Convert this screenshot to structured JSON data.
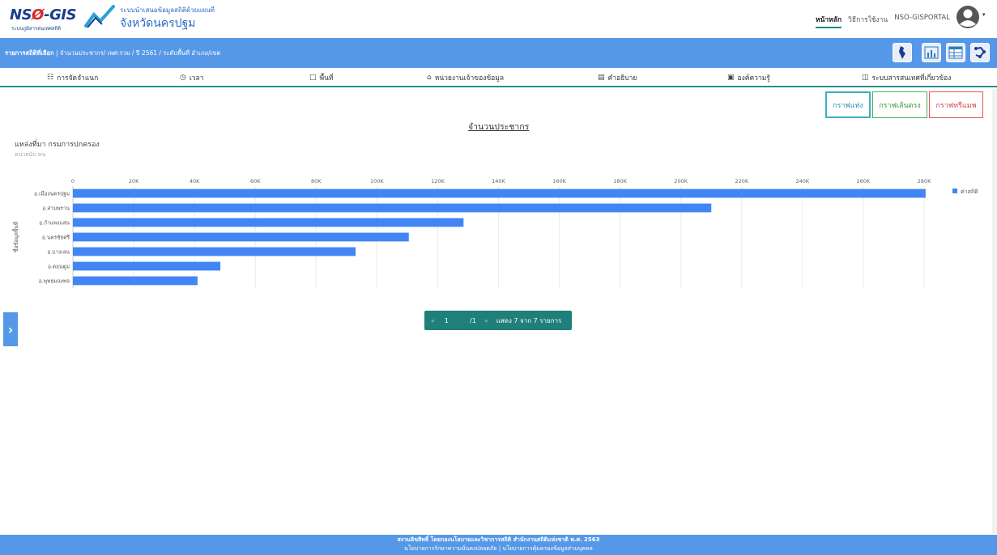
{
  "header": {
    "logo_text_a": "NS",
    "logo_text_o": "Ø",
    "logo_text_b": "-GIS",
    "logo_sub": "ระบบภูมิสารสนเทศสถิติ",
    "site_title_1": "ระบบนำเสนอข้อมูลสถิติด้วยแผนที่",
    "site_title_2": "จังหวัดนครปฐม",
    "nav": [
      {
        "label": "หน้าหลัก"
      },
      {
        "label": "วิธีการใช้งาน"
      },
      {
        "label": "NSO-GISPORTAL"
      }
    ]
  },
  "bluebar": {
    "label": "รายการสถิติที่เลือก",
    "text": " | จำนวนประชากร/ เพศ:รวม / ปี 2561 / ระดับพื้นที่ อำเภอ/เขต"
  },
  "menu": [
    {
      "label": "การจัดจำแนก",
      "icon": "sitemap-icon"
    },
    {
      "label": "เวลา",
      "icon": "clock-icon"
    },
    {
      "label": "พื้นที่",
      "icon": "area-icon"
    },
    {
      "label": "หน่วยงานเจ้าของข้อมูล",
      "icon": "bank-icon"
    },
    {
      "label": "คำอธิบาย",
      "icon": "description-icon"
    },
    {
      "label": "องค์ความรู้",
      "icon": "knowledge-icon"
    },
    {
      "label": "ระบบสารสนเทศที่เกี่ยวข้อง",
      "icon": "related-systems-icon"
    }
  ],
  "graph_buttons": {
    "bar": "กราฟแท่ง",
    "line": "กราฟเส้นตรง",
    "tree": "กราฟทรีแมพ"
  },
  "chart_header": {
    "title": "จำนวนประชากร",
    "source": "แหล่งที่มา กรมการปกครอง",
    "unit": "หน่วยนับ คน"
  },
  "chart_data": {
    "type": "bar",
    "orientation": "horizontal",
    "title": "จำนวนประชากร",
    "xlabel": "",
    "ylabel": "ชื่อข้อมูลพื้นที่",
    "xlim": [
      0,
      280000
    ],
    "x_ticks": [
      "0",
      "20K",
      "40K",
      "60K",
      "80K",
      "100K",
      "120K",
      "140K",
      "160K",
      "180K",
      "200K",
      "220K",
      "240K",
      "260K",
      "280K"
    ],
    "categories": [
      "อ.เมืองนครปฐม",
      "อ.สามพราน",
      "อ.กำแพงแสน",
      "อ.นครชัยศรี",
      "อ.บางเลน",
      "อ.ดอนตูม",
      "อ.พุทธมณฑล"
    ],
    "series": [
      {
        "name": "ค่าสถิติ",
        "values": [
          280500,
          210000,
          128500,
          110500,
          93000,
          48500,
          41000
        ],
        "color": "#4285f4"
      }
    ],
    "legend_position": "top-right",
    "grid": true
  },
  "pager": {
    "first": "«",
    "page": "1",
    "of": "/1",
    "next": "»",
    "summary": "แสดง 7 จาก 7 รายการ"
  },
  "footer": {
    "line1": "สงวนลิขสิทธิ์ โดยกองนโยบายและวิชาการสถิติ สำนักงานสถิติแห่งชาติ พ.ศ. 2563",
    "line2": "นโยบายการรักษาความมั่นคงปลอดภัย | นโยบายการคุ้มครองข้อมูลส่วนบุคคล"
  }
}
